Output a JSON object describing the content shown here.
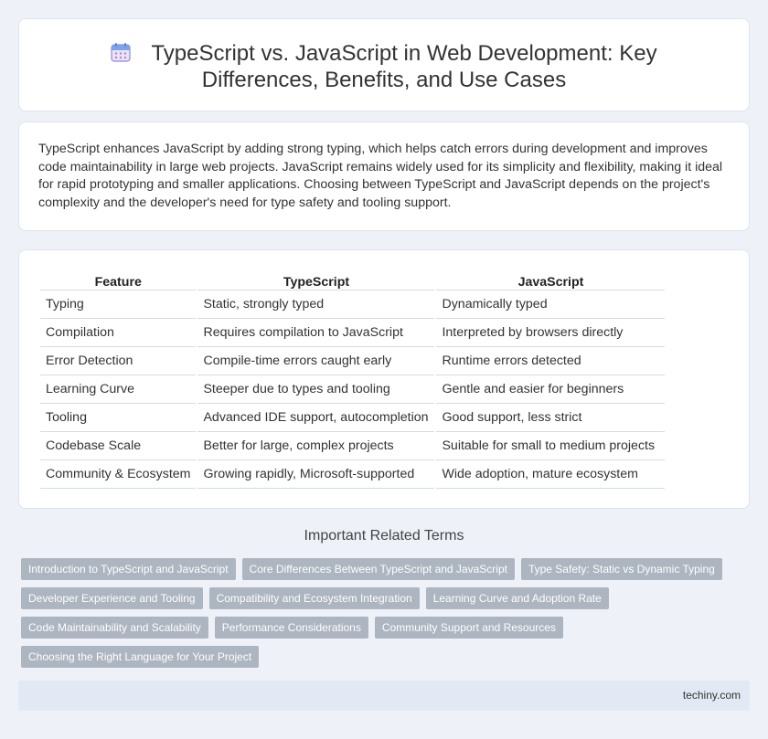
{
  "header": {
    "title": "TypeScript vs. JavaScript in Web Development: Key Differences, Benefits, and Use Cases",
    "icon": "calendar-icon"
  },
  "intro": {
    "text": "TypeScript enhances JavaScript by adding strong typing, which helps catch errors during development and improves code maintainability in large web projects. JavaScript remains widely used for its simplicity and flexibility, making it ideal for rapid prototyping and smaller applications. Choosing between TypeScript and JavaScript depends on the project's complexity and the developer's need for type safety and tooling support."
  },
  "table": {
    "headers": [
      "Feature",
      "TypeScript",
      "JavaScript"
    ],
    "rows": [
      [
        "Typing",
        "Static, strongly typed",
        "Dynamically typed"
      ],
      [
        "Compilation",
        "Requires compilation to JavaScript",
        "Interpreted by browsers directly"
      ],
      [
        "Error Detection",
        "Compile-time errors caught early",
        "Runtime errors detected"
      ],
      [
        "Learning Curve",
        "Steeper due to types and tooling",
        "Gentle and easier for beginners"
      ],
      [
        "Tooling",
        "Advanced IDE support, autocompletion",
        "Good support, less strict"
      ],
      [
        "Codebase Scale",
        "Better for large, complex projects",
        "Suitable for small to medium projects"
      ],
      [
        "Community & Ecosystem",
        "Growing rapidly, Microsoft-supported",
        "Wide adoption, mature ecosystem"
      ]
    ]
  },
  "related": {
    "heading": "Important Related Terms",
    "tags": [
      [
        "Introduction to TypeScript and JavaScript",
        "Core Differences Between TypeScript and JavaScript",
        "Type Safety: Static vs Dynamic Typing"
      ],
      [
        "Developer Experience and Tooling",
        "Compatibility and Ecosystem Integration",
        "Learning Curve and Adoption Rate"
      ],
      [
        "Code Maintainability and Scalability",
        "Performance Considerations",
        "Community Support and Resources"
      ],
      [
        "Choosing the Right Language for Your Project"
      ]
    ]
  },
  "footer": {
    "brand": "techiny.com"
  },
  "colors": {
    "background": "#eef2f8",
    "tag": "#adb5c0",
    "footer": "#e3e9f4"
  }
}
